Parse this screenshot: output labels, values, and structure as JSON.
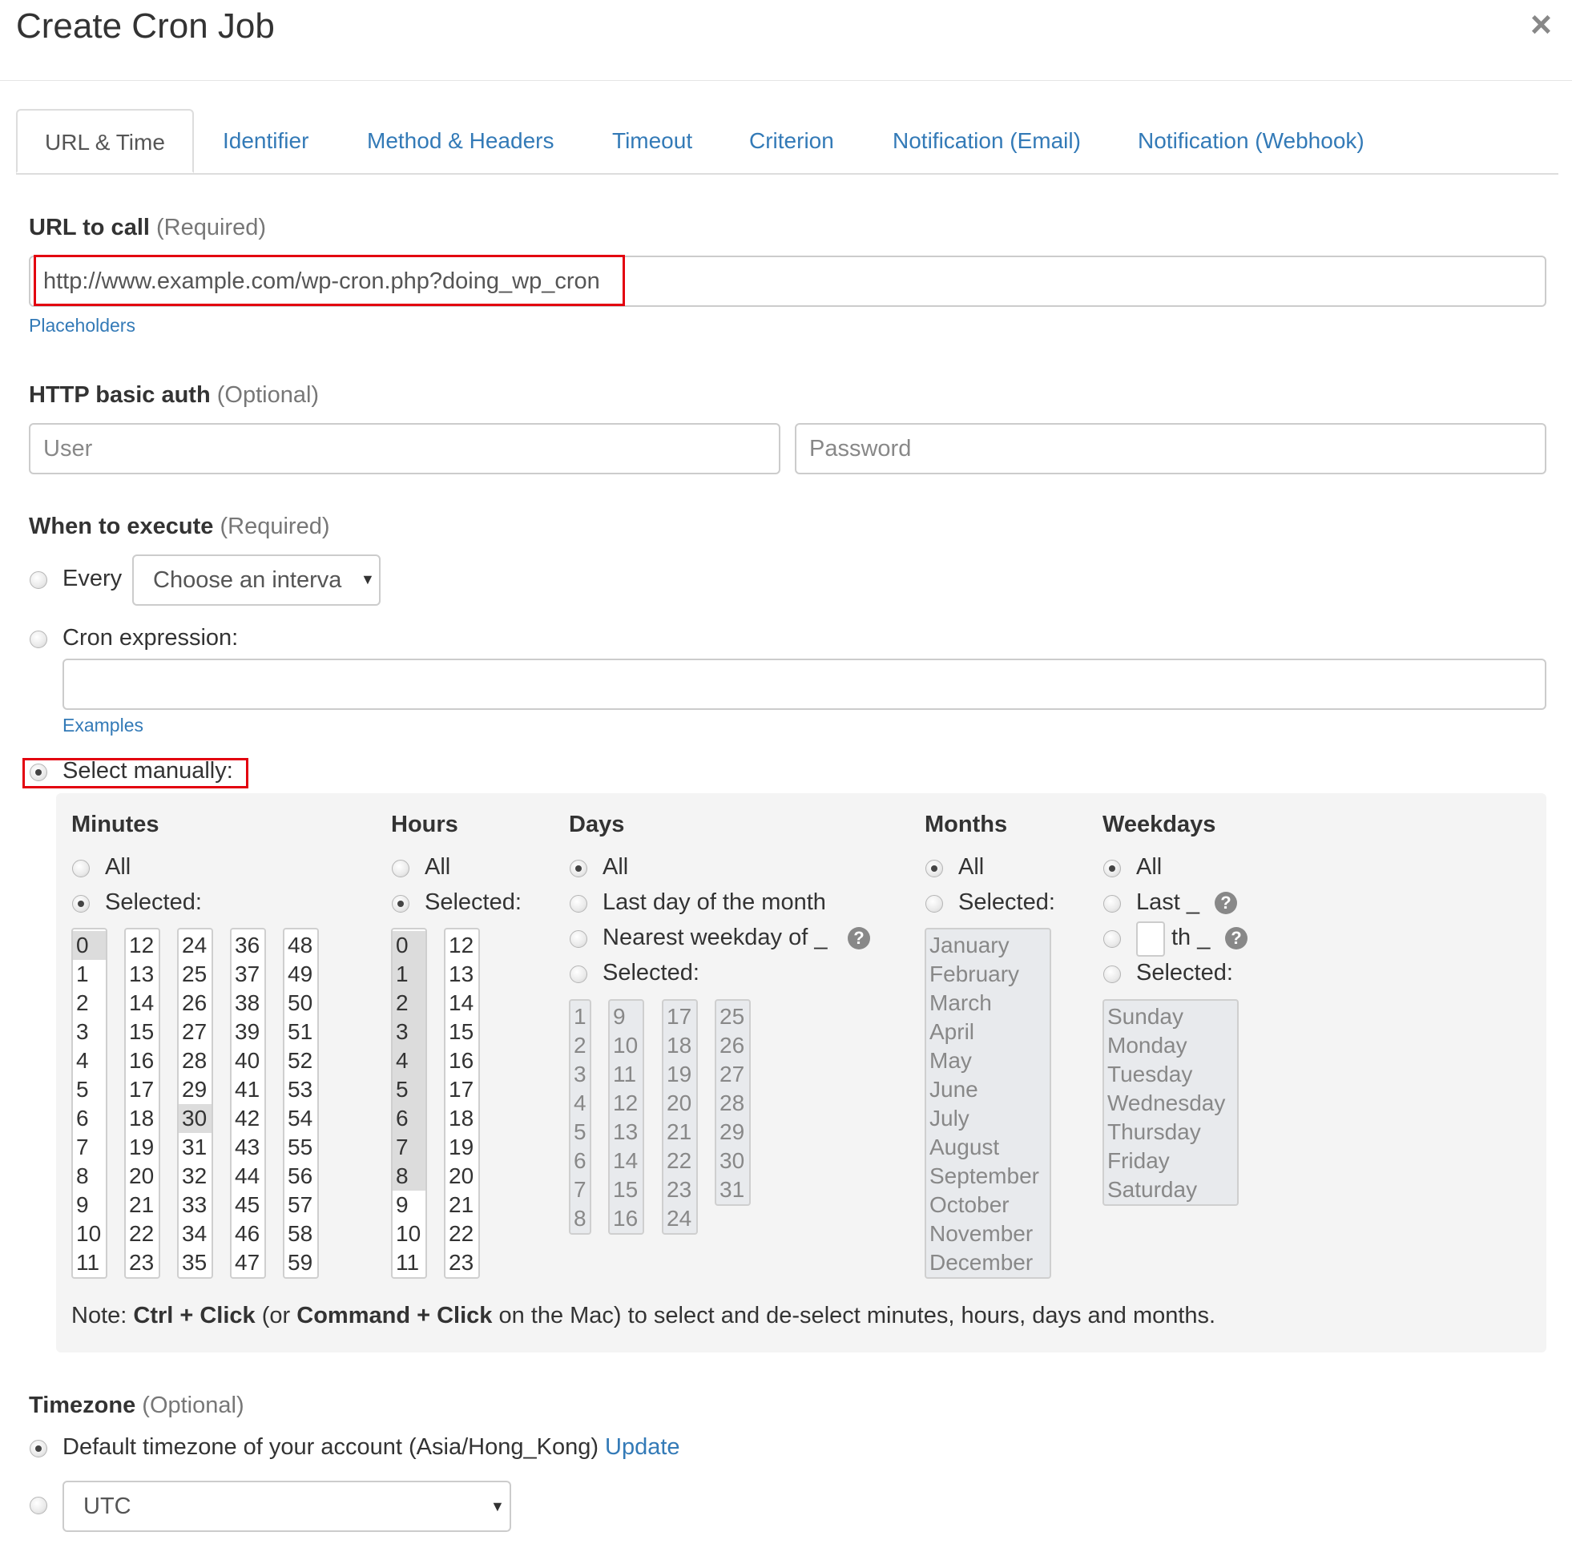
{
  "dialog": {
    "title": "Create Cron Job"
  },
  "tabs": [
    "URL & Time",
    "Identifier",
    "Method & Headers",
    "Timeout",
    "Criterion",
    "Notification (Email)",
    "Notification (Webhook)"
  ],
  "url": {
    "label": "URL to call",
    "suffix": "(Required)",
    "value": "http://www.example.com/wp-cron.php?doing_wp_cron",
    "link": "Placeholders"
  },
  "auth": {
    "label": "HTTP basic auth",
    "suffix": "(Optional)",
    "user_placeholder": "User",
    "password_placeholder": "Password"
  },
  "execute": {
    "label": "When to execute",
    "suffix": "(Required)",
    "every_label": "Every",
    "every_select": "Choose an interva",
    "cron_label": "Cron expression:",
    "examples_link": "Examples",
    "manual_label": "Select manually:",
    "selected_option": "manual"
  },
  "manual": {
    "minutes": {
      "header": "Minutes",
      "all": "All",
      "selected": "Selected:",
      "values": [
        "0",
        "1",
        "2",
        "3",
        "4",
        "5",
        "6",
        "7",
        "8",
        "9",
        "10",
        "11",
        "12",
        "13",
        "14",
        "15",
        "16",
        "17",
        "18",
        "19",
        "20",
        "21",
        "22",
        "23",
        "24",
        "25",
        "26",
        "27",
        "28",
        "29",
        "30",
        "31",
        "32",
        "33",
        "34",
        "35",
        "36",
        "37",
        "38",
        "39",
        "40",
        "41",
        "42",
        "43",
        "44",
        "45",
        "46",
        "47",
        "48",
        "49",
        "50",
        "51",
        "52",
        "53",
        "54",
        "55",
        "56",
        "57",
        "58",
        "59"
      ],
      "selected_values": [
        "0",
        "30"
      ]
    },
    "hours": {
      "header": "Hours",
      "all": "All",
      "selected": "Selected:",
      "values": [
        "0",
        "1",
        "2",
        "3",
        "4",
        "5",
        "6",
        "7",
        "8",
        "9",
        "10",
        "11",
        "12",
        "13",
        "14",
        "15",
        "16",
        "17",
        "18",
        "19",
        "20",
        "21",
        "22",
        "23"
      ],
      "selected_values": [
        "0",
        "1",
        "2",
        "3",
        "4",
        "5",
        "6",
        "7",
        "8"
      ]
    },
    "days": {
      "header": "Days",
      "all": "All",
      "last_day": "Last day of the month",
      "nearest": "Nearest weekday of _",
      "selected": "Selected:",
      "values": [
        "1",
        "2",
        "3",
        "4",
        "5",
        "6",
        "7",
        "8",
        "9",
        "10",
        "11",
        "12",
        "13",
        "14",
        "15",
        "16",
        "17",
        "18",
        "19",
        "20",
        "21",
        "22",
        "23",
        "24",
        "25",
        "26",
        "27",
        "28",
        "29",
        "30",
        "31"
      ]
    },
    "months": {
      "header": "Months",
      "all": "All",
      "selected": "Selected:",
      "values": [
        "January",
        "February",
        "March",
        "April",
        "May",
        "June",
        "July",
        "August",
        "September",
        "October",
        "November",
        "December"
      ]
    },
    "weekdays": {
      "header": "Weekdays",
      "all": "All",
      "last": "Last _",
      "nth": "th _",
      "selected": "Selected:",
      "values": [
        "Sunday",
        "Monday",
        "Tuesday",
        "Wednesday",
        "Thursday",
        "Friday",
        "Saturday"
      ]
    },
    "note": {
      "prefix": "Note: ",
      "ctrl": "Ctrl + Click",
      "mid1": " (or ",
      "cmd": "Command + Click",
      "rest": " on the Mac) to select and de-select minutes, hours, days and months."
    }
  },
  "timezone": {
    "label": "Timezone",
    "suffix": "(Optional)",
    "default_text": "Default timezone of your account (Asia/Hong_Kong)",
    "update_link": "Update",
    "select_value": "UTC"
  },
  "icons": {
    "close": "close-icon",
    "help": "help-circle-icon",
    "caret": "caret-down-icon"
  },
  "colors": {
    "link": "#337ab7",
    "highlight": "#e3000f",
    "panel": "#f4f4f4"
  }
}
